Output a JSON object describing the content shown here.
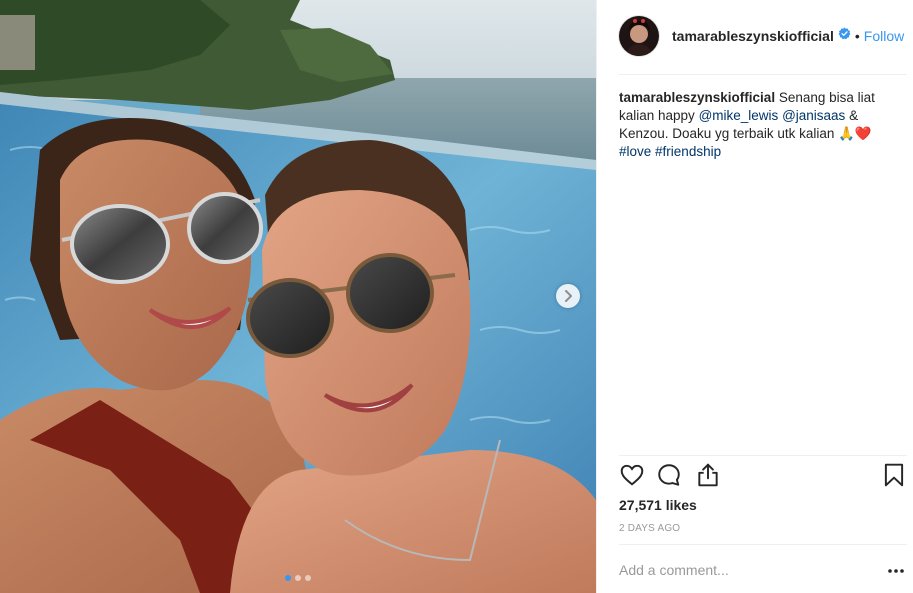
{
  "post": {
    "username": "tamarableszynskiofficial",
    "verified": true,
    "follow_label": "Follow",
    "bullet": "•",
    "caption": {
      "username": "tamarableszynskiofficial",
      "text_1": " Senang bisa liat kalian happy ",
      "mention_1": "@mike_lewis",
      "text_2": " ",
      "mention_2": "@janisaas",
      "text_3": " & Kenzou. Doaku yg terbaik utk kalian 🙏❤️",
      "hashtag_1": "#love",
      "hashtag_2": "#friendship"
    },
    "likes": "27,571 likes",
    "time_ago": "2 DAYS AGO",
    "comment_placeholder": "Add a comment...",
    "carousel": {
      "slides": 3,
      "active_index": 0
    }
  },
  "icons": {
    "like": "heart-icon",
    "comment": "comment-icon",
    "share": "share-icon",
    "save": "bookmark-icon",
    "more": "more-options-icon",
    "next": "chevron-right-icon",
    "verified": "verified-badge-icon"
  },
  "colors": {
    "link": "#3897f0",
    "mention": "#003569",
    "text": "#262626",
    "muted": "#999999"
  }
}
